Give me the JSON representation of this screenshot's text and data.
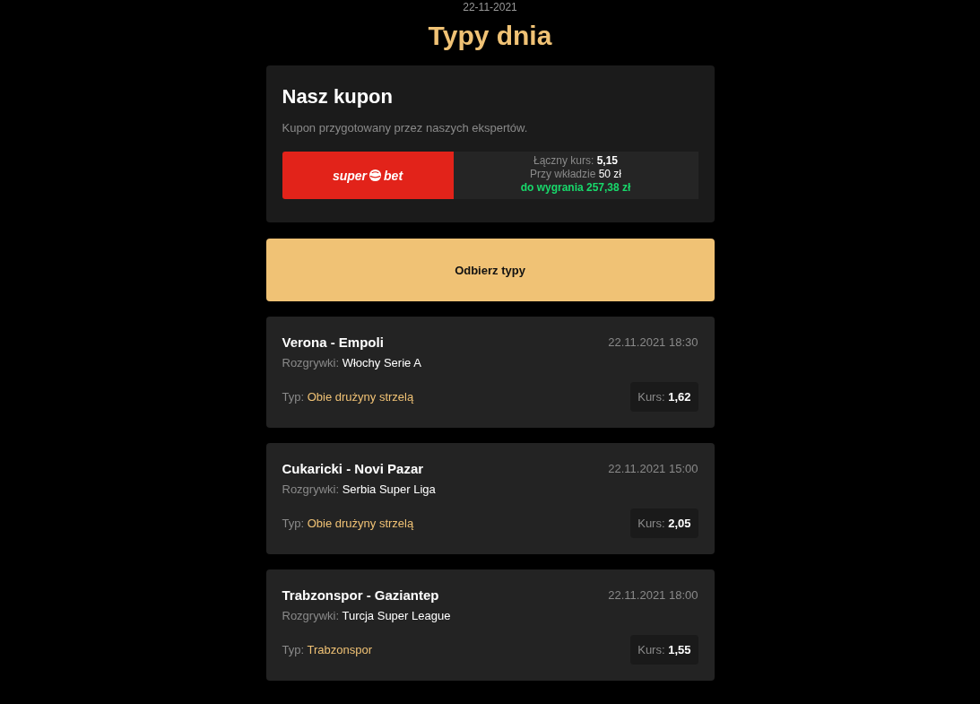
{
  "date": "22-11-2021",
  "title": "Typy dnia",
  "coupon": {
    "heading": "Nasz kupon",
    "description": "Kupon przygotowany przez naszych ekspertów.",
    "bookmaker": {
      "logo_left": "super",
      "logo_right": "bet"
    },
    "total_odds_label": "Łączny kurs:",
    "total_odds": "5,15",
    "stake_label": "Przy wkładzie",
    "stake": "50 zł",
    "win": "do wygrania 257,38 zł"
  },
  "cta_button": "Odbierz typy",
  "tips": [
    {
      "match": "Verona - Empoli",
      "datetime": "22.11.2021 18:30",
      "competition_label": "Rozgrywki:",
      "competition": "Włochy Serie A",
      "type_label": "Typ:",
      "type": "Obie drużyny strzelą",
      "odds_label": "Kurs:",
      "odds": "1,62"
    },
    {
      "match": "Cukaricki - Novi Pazar",
      "datetime": "22.11.2021 15:00",
      "competition_label": "Rozgrywki:",
      "competition": "Serbia Super Liga",
      "type_label": "Typ:",
      "type": "Obie drużyny strzelą",
      "odds_label": "Kurs:",
      "odds": "2,05"
    },
    {
      "match": "Trabzonspor - Gaziantep",
      "datetime": "22.11.2021 18:00",
      "competition_label": "Rozgrywki:",
      "competition": "Turcja Super League",
      "type_label": "Typ:",
      "type": "Trabzonspor",
      "odds_label": "Kurs:",
      "odds": "1,55"
    }
  ]
}
